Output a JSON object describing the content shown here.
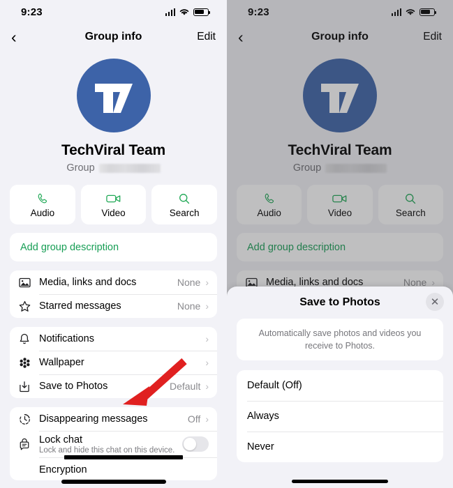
{
  "status_bar": {
    "time": "9:23",
    "cellular_icon": "signal-bars-icon",
    "wifi_icon": "wifi-icon",
    "battery_icon": "battery-icon"
  },
  "nav": {
    "back_icon": "back-chevron-icon",
    "title": "Group info",
    "edit_label": "Edit"
  },
  "profile": {
    "avatar_initials": "TV",
    "avatar_color": "#3d63a8",
    "name": "TechViral Team",
    "subtitle_prefix": "Group",
    "subtitle_redacted": true
  },
  "actions": [
    {
      "icon": "phone-icon",
      "label": "Audio"
    },
    {
      "icon": "video-camera-icon",
      "label": "Video"
    },
    {
      "icon": "search-icon",
      "label": "Search"
    }
  ],
  "description": {
    "label": "Add group description",
    "color": "#179e55"
  },
  "accent_green": "#1fa855",
  "annotation_color": "#e02020",
  "list_groups": [
    {
      "rows": [
        {
          "icon": "photo-icon",
          "label": "Media, links and docs",
          "value": "None",
          "chevron": "›"
        },
        {
          "icon": "star-icon",
          "label": "Starred messages",
          "value": "None",
          "chevron": "›"
        }
      ]
    },
    {
      "rows": [
        {
          "icon": "bell-icon",
          "label": "Notifications",
          "value": "",
          "chevron": "›"
        },
        {
          "icon": "wallpaper-icon",
          "label": "Wallpaper",
          "value": "",
          "chevron": "›"
        },
        {
          "icon": "save-download-icon",
          "label": "Save to Photos",
          "value": "Default",
          "chevron": "›"
        }
      ]
    },
    {
      "rows": [
        {
          "icon": "timer-icon",
          "label": "Disappearing messages",
          "value": "Off",
          "chevron": "›"
        },
        {
          "icon": "lock-chat-icon",
          "label": "Lock chat",
          "sublabel": "Lock and hide this chat on this device.",
          "toggle": "off"
        },
        {
          "icon": "encryption-icon",
          "label": "Encryption"
        }
      ]
    }
  ],
  "modal": {
    "title": "Save to Photos",
    "close_icon": "close-icon",
    "note": "Automatically save photos and videos you receive to Photos.",
    "options": [
      {
        "label": "Default (Off)"
      },
      {
        "label": "Always"
      },
      {
        "label": "Never"
      }
    ]
  },
  "annotations": {
    "left_arrow_target": "Save to Photos",
    "right_arrow_target": "Always"
  }
}
